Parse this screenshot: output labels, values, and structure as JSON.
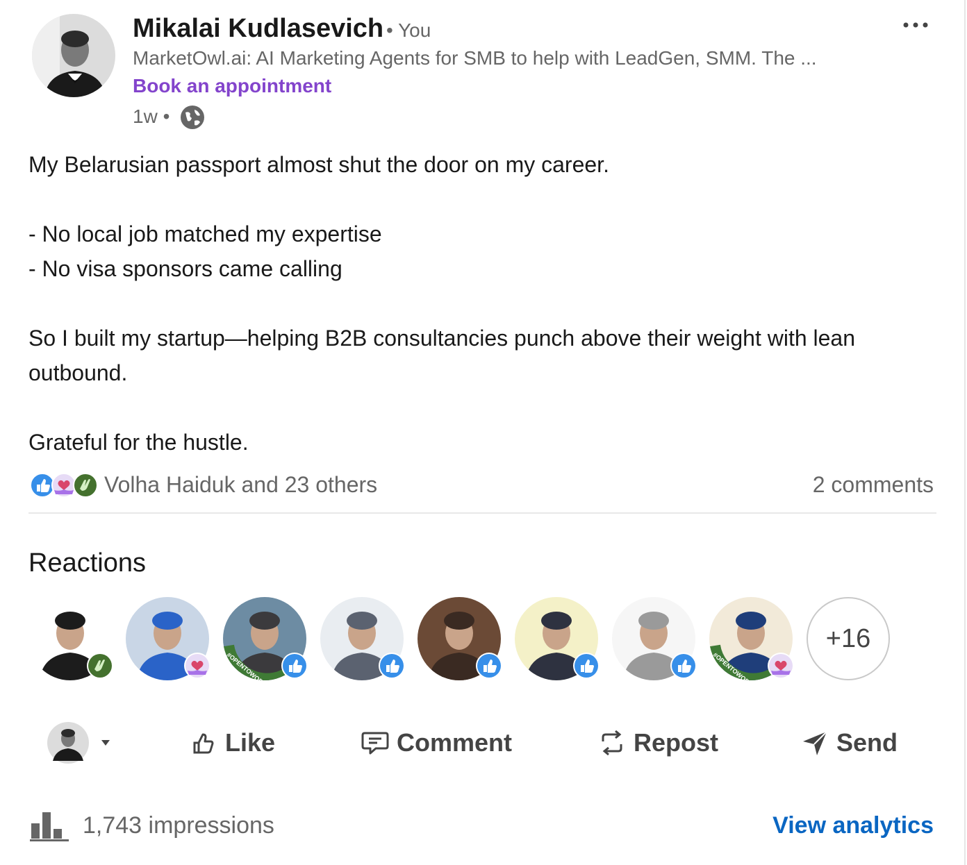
{
  "author": {
    "name": "Mikalai Kudlasevich",
    "you_tag": "• You",
    "headline": "MarketOwl.ai: AI Marketing Agents for SMB to help with LeadGen, SMM. The ...",
    "book_link": "Book an appointment",
    "time": "1w •"
  },
  "post": {
    "text": "My Belarusian passport almost shut the door on my career.\n\n- No local job matched my expertise\n- No visa sponsors came calling\n\nSo I built my startup—helping B2B consultancies punch above their weight with lean outbound.\n\nGrateful for the hustle."
  },
  "social": {
    "reactors_text": "Volha Haiduk and 23 others",
    "comments": "2 comments",
    "reaction_types": [
      "like-icon",
      "support-icon",
      "celebrate-icon"
    ]
  },
  "reactions": {
    "title": "Reactions",
    "more": "+16",
    "people": [
      {
        "badge": "celebrate-icon",
        "color": "#1c1c1c",
        "bg": "#ffffff"
      },
      {
        "badge": "support-icon",
        "color": "#2a63c8",
        "bg": "#c9d6e6"
      },
      {
        "badge": "like-icon",
        "color": "#3b3a3d",
        "bg": "#6d8ca3",
        "frame": "#OPENTOWORK"
      },
      {
        "badge": "like-icon",
        "color": "#5b6270",
        "bg": "#e9edf1"
      },
      {
        "badge": "like-icon",
        "color": "#3a2a22",
        "bg": "#6b4a36"
      },
      {
        "badge": "like-icon",
        "color": "#2e3240",
        "bg": "#f4f1c8"
      },
      {
        "badge": "like-icon",
        "color": "#9a9a9a",
        "bg": "#f6f6f6"
      },
      {
        "badge": "support-icon",
        "color": "#1f3e7a",
        "bg": "#f2ead9",
        "frame": "#OPENTOWORK"
      }
    ]
  },
  "actions": {
    "like": "Like",
    "comment": "Comment",
    "repost": "Repost",
    "send": "Send"
  },
  "footer": {
    "impressions": "1,743 impressions",
    "view_analytics": "View analytics"
  },
  "colors": {
    "brand_link": "#0a66c2",
    "book_link": "#8344cc",
    "like_blue": "#378fe9",
    "celebrate_green": "#44712e",
    "support_purple": "#a872e8"
  }
}
